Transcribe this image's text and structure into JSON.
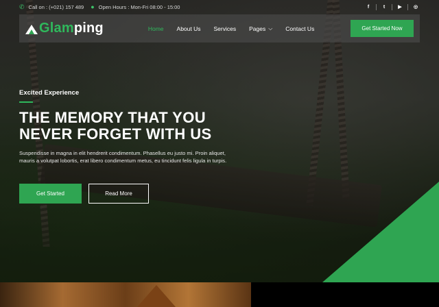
{
  "topbar": {
    "phone_icon": "phone-icon",
    "phone": "Call on : (+021) 157 489",
    "clock_icon": "clock-icon",
    "hours": "Open Hours : Mon-Fri 08:00 - 15:00",
    "social": [
      {
        "icon": "facebook-icon",
        "glyph": "f"
      },
      {
        "icon": "twitter-icon",
        "glyph": "t"
      },
      {
        "icon": "youtube-icon",
        "glyph": "▶"
      },
      {
        "icon": "instagram-icon",
        "glyph": "◎"
      }
    ]
  },
  "nav": {
    "logo_part1": "Glam",
    "logo_part2": "ping",
    "menu": [
      {
        "label": "Home",
        "active": true
      },
      {
        "label": "About Us"
      },
      {
        "label": "Services"
      },
      {
        "label": "Pages",
        "dropdown": true
      },
      {
        "label": "Contact Us"
      }
    ],
    "chevron": "⌵",
    "cta": "Get Started Now"
  },
  "hero": {
    "kicker": "Excited Experience",
    "headline_line1": "THE MEMORY THAT YOU",
    "headline_line2": "NEVER FORGET WITH US",
    "description": "Suspendisse in magna in elit hendrerit condimentum. Phasellus eu justo mi. Proin aliquet, mauris a volutpat lobortis, erat libero condimentum metus, eu tincidunt felis ligula in turpis.",
    "primary_button": "Get Started",
    "secondary_button": "Read More"
  },
  "colors": {
    "accent": "#2fa552",
    "accent_text": "#2fb85c"
  }
}
